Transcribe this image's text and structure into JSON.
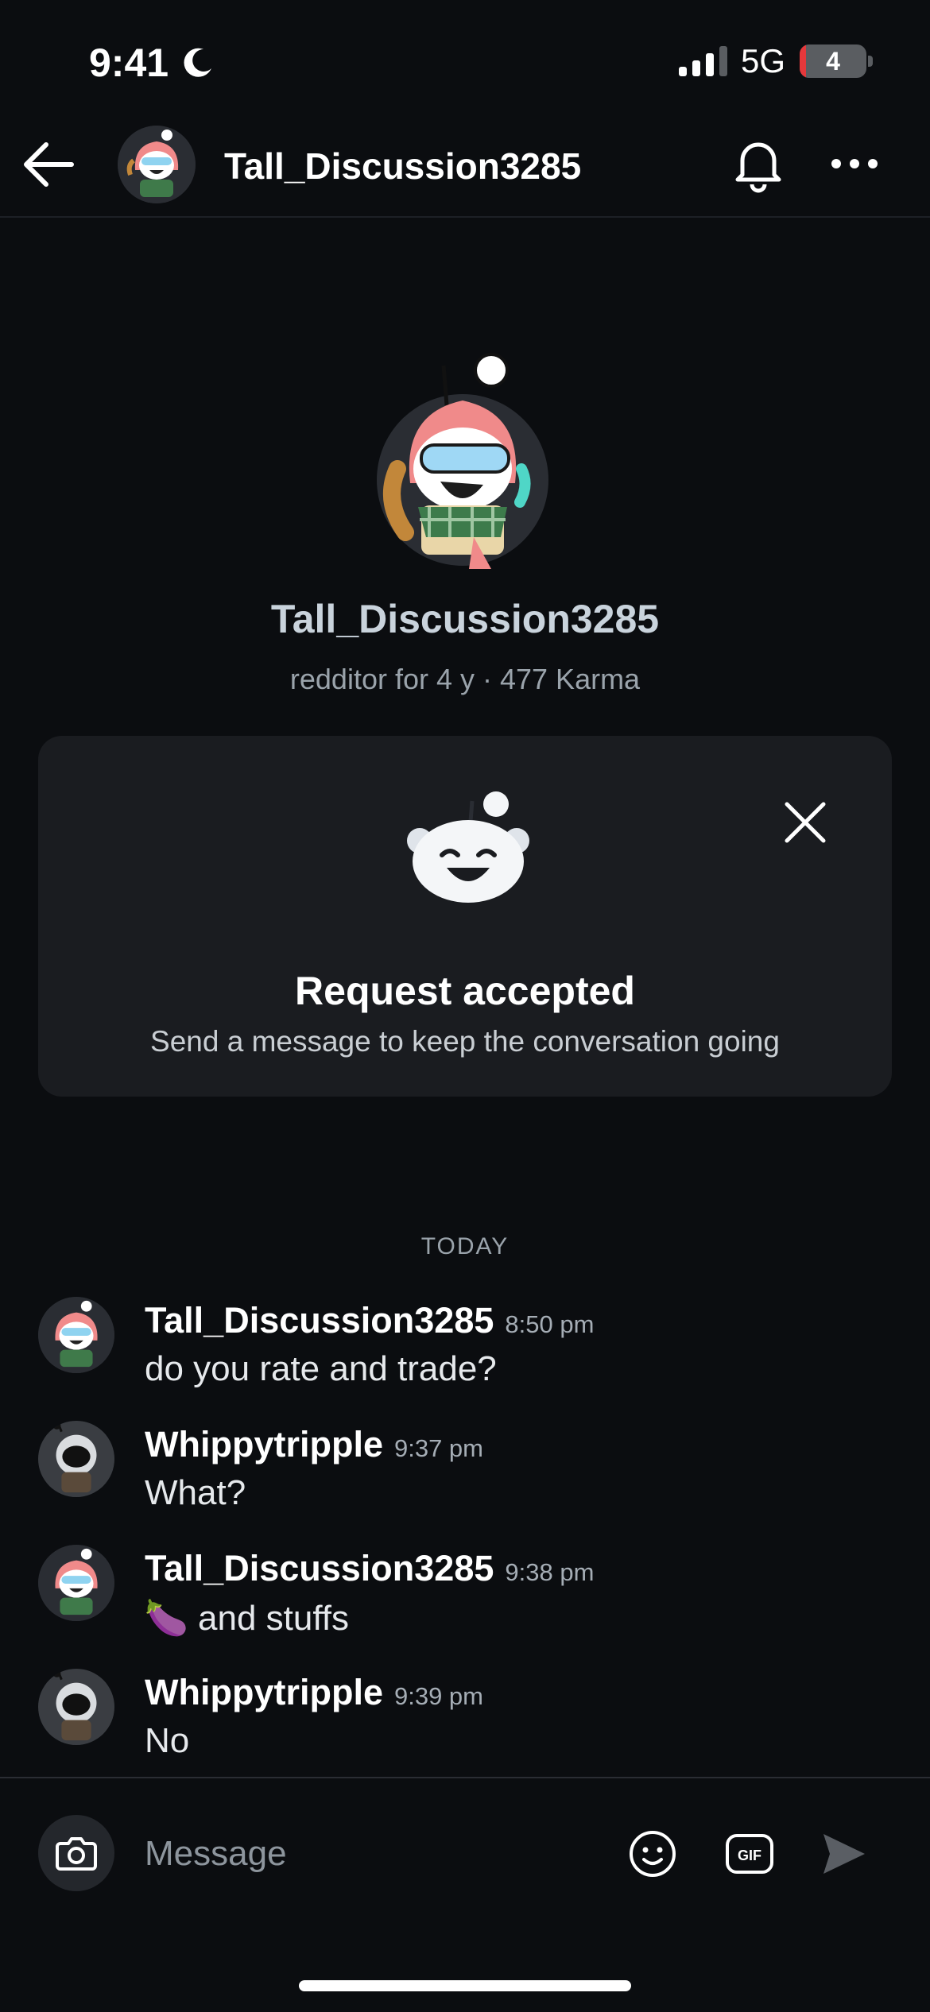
{
  "status_bar": {
    "time": "9:41",
    "network": "5G",
    "battery": "4"
  },
  "header": {
    "title": "Tall_Discussion3285"
  },
  "profile": {
    "username": "Tall_Discussion3285",
    "meta": "redditor for 4 y · 477 Karma"
  },
  "request_card": {
    "title": "Request accepted",
    "subtitle": "Send a message to keep the conversation going"
  },
  "date_separator": "TODAY",
  "messages": [
    {
      "author": "Tall_Discussion3285",
      "time": "8:50 pm",
      "text": "do you rate and trade?",
      "avatar": "tall-discussion-avatar"
    },
    {
      "author": "Whippytripple",
      "time": "9:37 pm",
      "text": "What?",
      "avatar": "whippytripple-avatar"
    },
    {
      "author": "Tall_Discussion3285",
      "time": "9:38 pm",
      "text": "🍆 and stuffs",
      "avatar": "tall-discussion-avatar"
    },
    {
      "author": "Whippytripple",
      "time": "9:39 pm",
      "text": "No",
      "avatar": "whippytripple-avatar"
    }
  ],
  "composer": {
    "placeholder": "Message"
  },
  "colors": {
    "background": "#0b0d10",
    "card": "#1a1c20",
    "text": "#ffffff",
    "muted": "#9aa3ab"
  },
  "icons": [
    "back-arrow-icon",
    "bell-icon",
    "more-icon",
    "close-icon",
    "camera-icon",
    "emoji-icon",
    "gif-icon",
    "send-icon",
    "moon-icon",
    "signal-icon"
  ]
}
